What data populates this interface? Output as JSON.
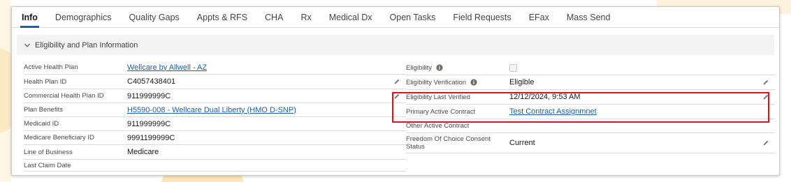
{
  "tabs": [
    {
      "label": "Info",
      "active": true
    },
    {
      "label": "Demographics",
      "active": false
    },
    {
      "label": "Quality Gaps",
      "active": false
    },
    {
      "label": "Appts & RFS",
      "active": false
    },
    {
      "label": "CHA",
      "active": false
    },
    {
      "label": "Rx",
      "active": false
    },
    {
      "label": "Medical Dx",
      "active": false
    },
    {
      "label": "Open Tasks",
      "active": false
    },
    {
      "label": "Field Requests",
      "active": false
    },
    {
      "label": "EFax",
      "active": false
    },
    {
      "label": "Mass Send",
      "active": false
    }
  ],
  "section": {
    "title": "Eligibility and Plan Information",
    "icon": "chevron-down-icon"
  },
  "left_fields": [
    {
      "label": "Active Health Plan",
      "value": "Wellcare by Allwell - AZ",
      "link": true,
      "editable": false
    },
    {
      "label": "Health Plan ID",
      "value": "C4057438401",
      "link": false,
      "editable": true
    },
    {
      "label": "Commercial Health Plan ID",
      "value": "911999999C",
      "link": false,
      "editable": true
    },
    {
      "label": "Plan Benefits",
      "value": "H5590-008 - Wellcare Dual Liberty (HMO D-SNP)",
      "link": true,
      "editable": false
    },
    {
      "label": "Medicaid ID",
      "value": "911999999C",
      "link": false,
      "editable": false
    },
    {
      "label": "Medicare Beneficiary ID",
      "value": "9991199999C",
      "link": false,
      "editable": false
    },
    {
      "label": "Line of Business",
      "value": "Medicare",
      "link": false,
      "editable": false
    },
    {
      "label": "Last Claim Date",
      "value": "",
      "link": false,
      "editable": false
    }
  ],
  "right_fields": [
    {
      "label": "Eligibility",
      "info": true,
      "value": "",
      "checkbox": true,
      "checked": false,
      "link": false,
      "editable": false
    },
    {
      "label": "Eligibility Verification",
      "info": true,
      "value": "Eligible",
      "link": false,
      "editable": true
    },
    {
      "label": "Eligibility Last Verified",
      "info": false,
      "value": "12/12/2024, 9:53 AM",
      "link": false,
      "editable": true
    },
    {
      "label": "Primary Active Contract",
      "info": false,
      "value": "Test Contract Assignmnet",
      "link": true,
      "editable": false
    },
    {
      "label": "Other Active Contract",
      "info": false,
      "value": "",
      "link": false,
      "editable": false
    },
    {
      "label": "Freedom Of Choice Consent Status",
      "info": false,
      "value": "Current",
      "link": false,
      "editable": true
    }
  ],
  "colors": {
    "accent": "#1b5fb0",
    "highlight": "#e0121a",
    "section_bg": "#f3f3f3"
  }
}
